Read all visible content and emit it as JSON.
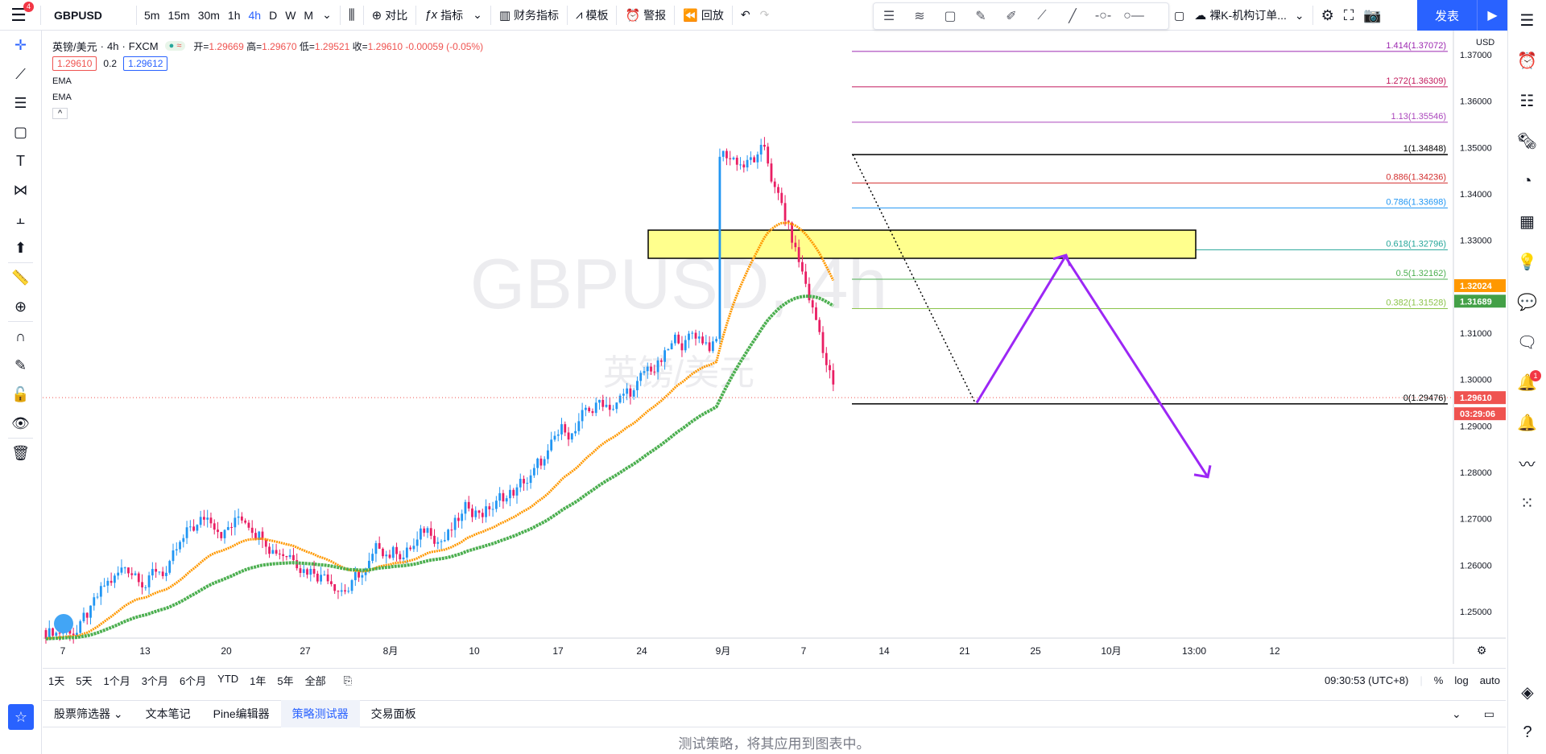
{
  "topbar": {
    "menu_badge": "4",
    "symbol": "GBPUSD",
    "intervals": [
      "5m",
      "15m",
      "30m",
      "1h",
      "4h",
      "D",
      "W",
      "M"
    ],
    "active_interval": "4h",
    "compare_label": "对比",
    "indicators_label": "指标",
    "financials_label": "财务指标",
    "templates_label": "模板",
    "alert_label": "警报",
    "replay_label": "回放",
    "layout_name": "裸K-机构订单...",
    "publish_label": "发表"
  },
  "legend": {
    "pair": "英镑/美元",
    "interval": "4h",
    "exchange": "FXCM",
    "open_label": "开=",
    "open": "1.29669",
    "high_label": "高=",
    "high": "1.29670",
    "low_label": "低=",
    "low": "1.29521",
    "close_label": "收=",
    "close": "1.29610",
    "change": "-0.00059 (-0.05%)",
    "bid": "1.29610",
    "spread": "0.2",
    "ask": "1.29612",
    "indicators": [
      "EMA",
      "EMA"
    ]
  },
  "watermark": {
    "symbol": "GBPUSD, 4h",
    "name": "英镑/美元"
  },
  "chart_data": {
    "type": "candlestick",
    "currency": "USD",
    "y_ticks": [
      "1.37000",
      "1.36000",
      "1.35000",
      "1.34000",
      "1.33000",
      "1.32000",
      "1.31000",
      "1.30000",
      "1.29000",
      "1.28000",
      "1.27000",
      "1.26000",
      "1.25000"
    ],
    "x_ticks": [
      "7",
      "13",
      "20",
      "27",
      "8月",
      "10",
      "17",
      "24",
      "9月",
      "7",
      "14",
      "21",
      "25",
      "10月",
      "13:00",
      "12"
    ],
    "fib_levels": [
      {
        "label": "1.414(1.37072)",
        "value": 1.37072,
        "color": "#9c27b0"
      },
      {
        "label": "1.272(1.36309)",
        "value": 1.36309,
        "color": "#c2185b"
      },
      {
        "label": "1.13(1.35546)",
        "value": 1.35546,
        "color": "#ab47bc"
      },
      {
        "label": "1(1.34848)",
        "value": 1.34848,
        "color": "#000000"
      },
      {
        "label": "0.886(1.34236)",
        "value": 1.34236,
        "color": "#d32f2f"
      },
      {
        "label": "0.786(1.33698)",
        "value": 1.33698,
        "color": "#2196f3"
      },
      {
        "label": "0.618(1.32796)",
        "value": 1.32796,
        "color": "#26a69a"
      },
      {
        "label": "0.5(1.32162)",
        "value": 1.32162,
        "color": "#4caf50"
      },
      {
        "label": "0.382(1.31528)",
        "value": 1.31528,
        "color": "#8bc34a"
      },
      {
        "label": "0(1.29476)",
        "value": 1.29476,
        "color": "#000000"
      }
    ],
    "price_labels": [
      {
        "value": "1.32024",
        "color": "#ff9800"
      },
      {
        "value": "1.31689",
        "color": "#43a047"
      },
      {
        "value": "1.29610",
        "color": "#ef5350"
      },
      {
        "value": "03:29:06",
        "color": "#ef5350"
      }
    ],
    "ema_fast_color": "#ff9800",
    "ema_slow_color": "#4caf50"
  },
  "rangebar": {
    "ranges": [
      "1天",
      "5天",
      "1个月",
      "3个月",
      "6个月",
      "YTD",
      "1年",
      "5年",
      "全部"
    ],
    "time": "09:30:53 (UTC+8)",
    "percent": "%",
    "log": "log",
    "auto": "auto"
  },
  "bottomtabs": {
    "tabs": [
      "股票筛选器",
      "文本笔记",
      "Pine编辑器",
      "策略测试器",
      "交易面板"
    ],
    "active": "策略测试器",
    "hint": "测试策略，将其应用到图表中。"
  },
  "rightpanel": {
    "alert_badge": "1"
  }
}
